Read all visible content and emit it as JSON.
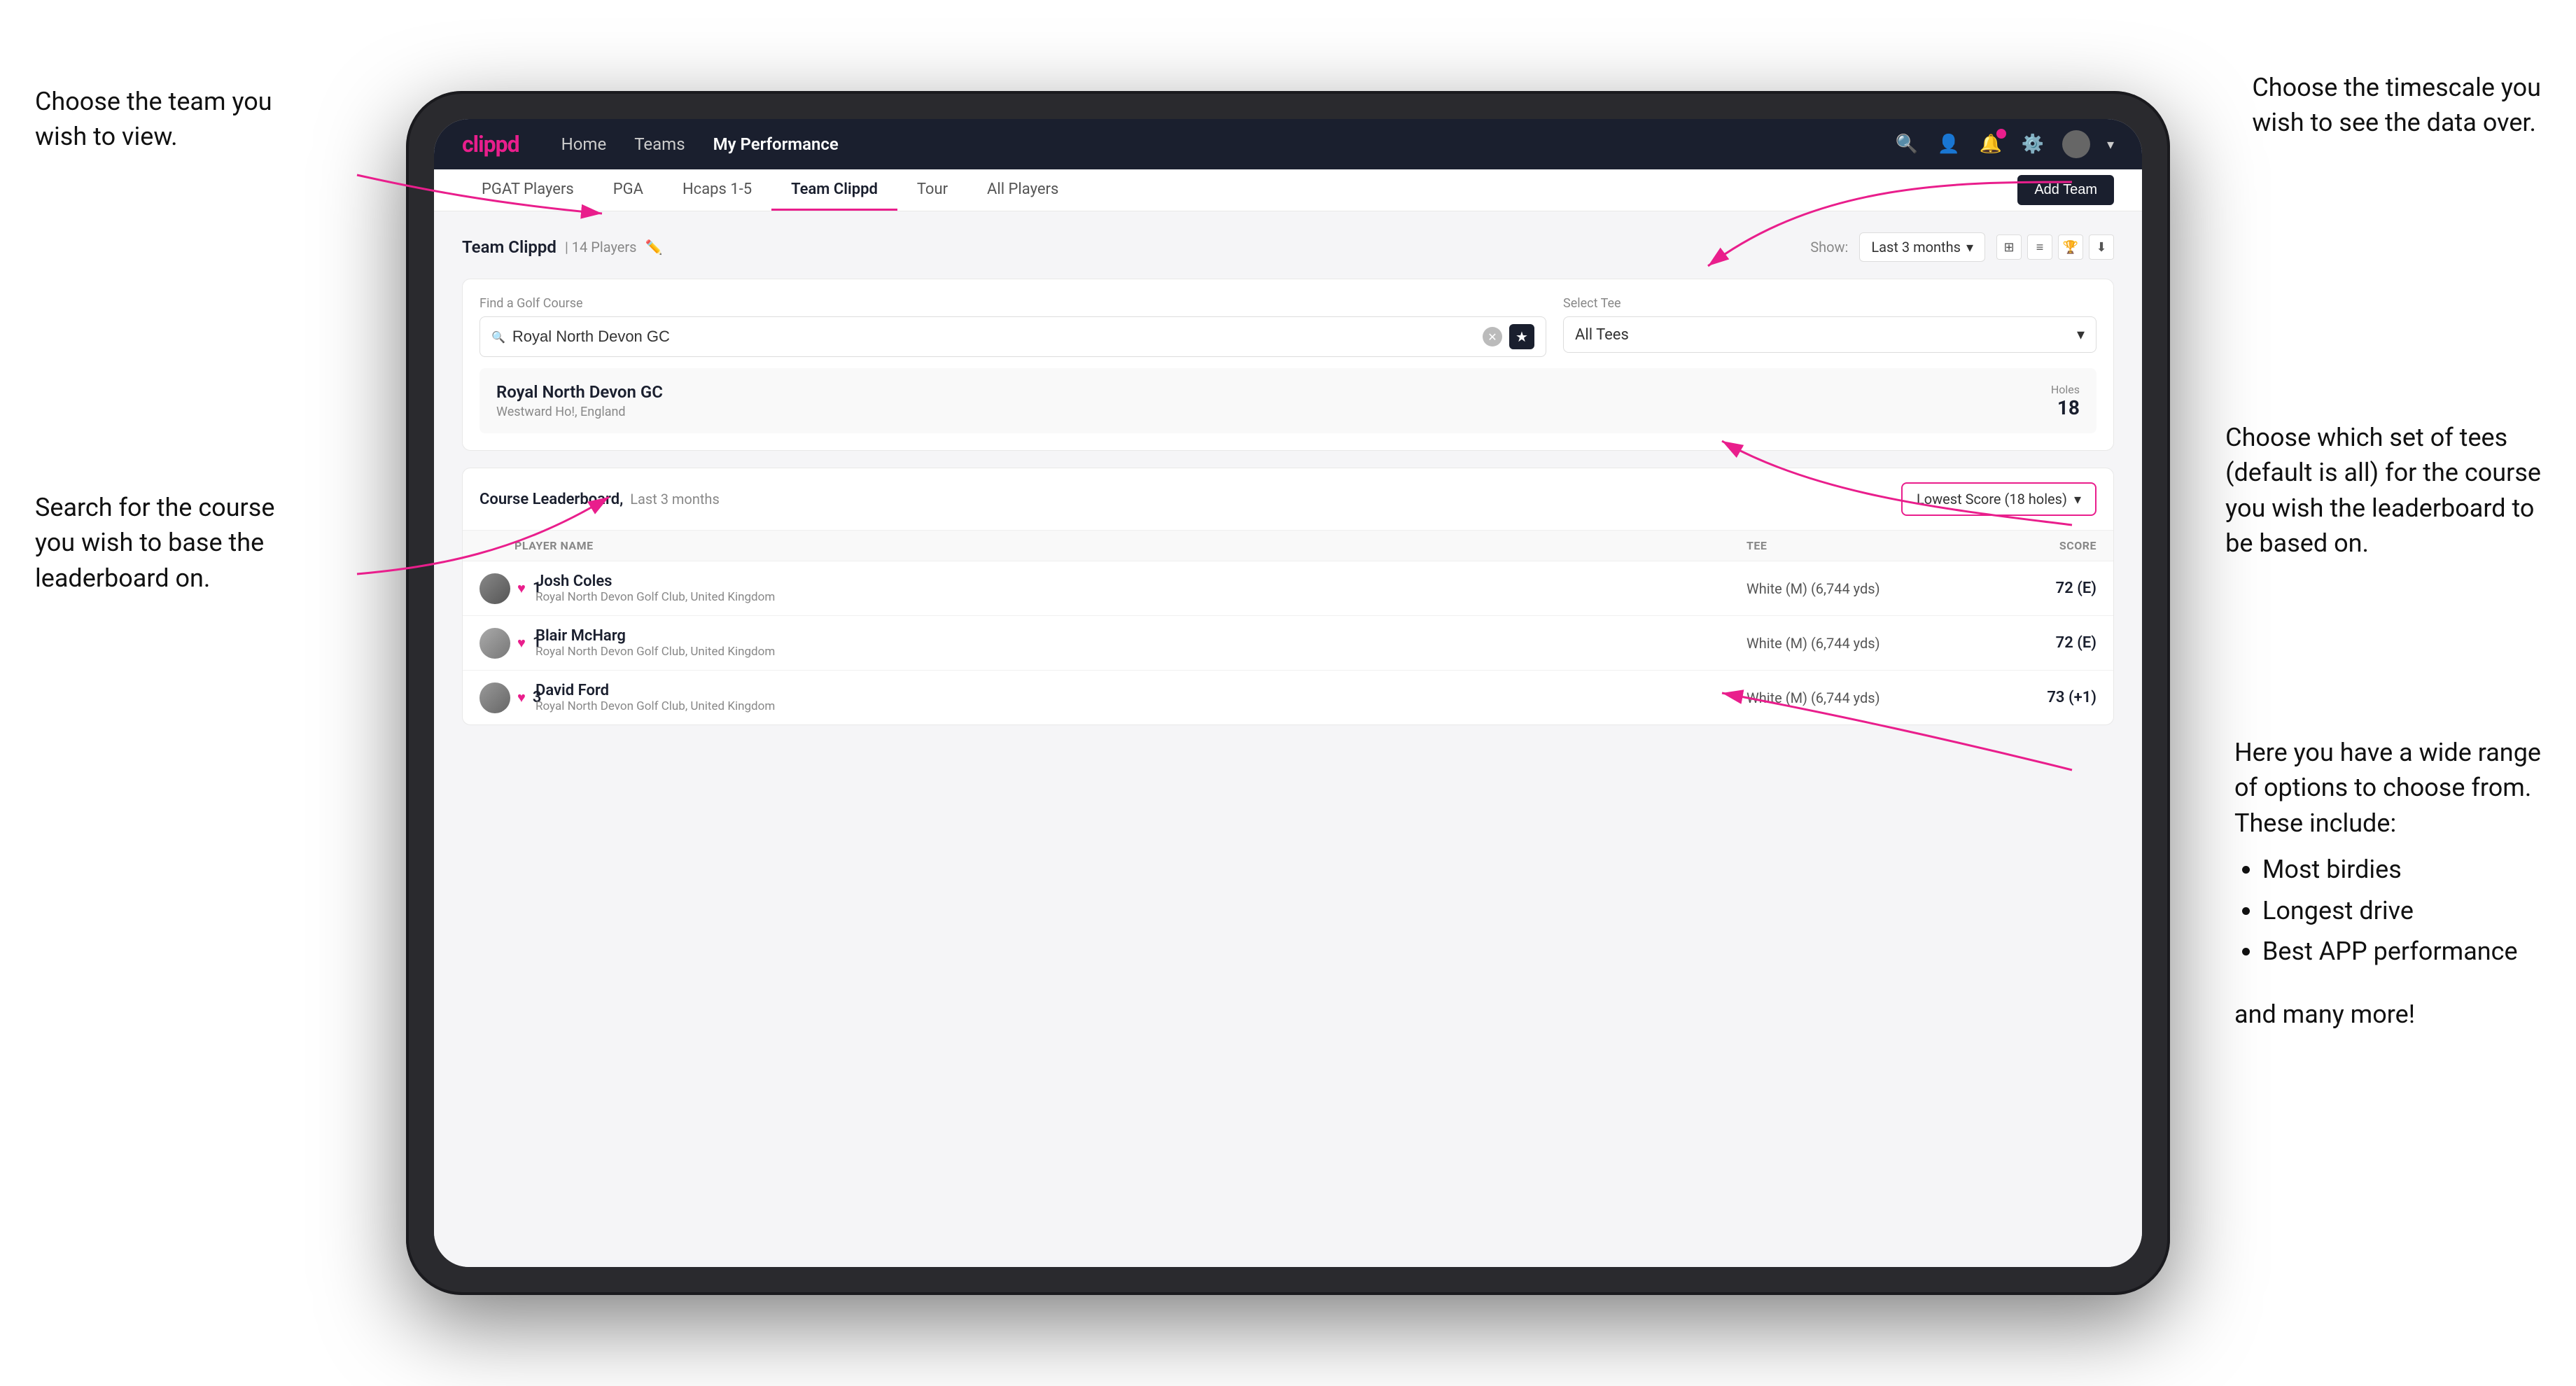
{
  "annotations": {
    "top_left": {
      "title": "Choose the team you\nwish to view."
    },
    "bottom_left": {
      "title": "Search for the course\nyou wish to base the\nleaderboard on."
    },
    "top_right": {
      "title": "Choose the timescale you\nwish to see the data over."
    },
    "middle_right": {
      "title": "Choose which set of tees\n(default is all) for the course\nyou wish the leaderboard to\nbe based on."
    },
    "lower_right": {
      "title": "Here you have a wide range\nof options to choose from.\nThese include:"
    },
    "bullet_items": [
      "Most birdies",
      "Longest drive",
      "Best APP performance"
    ],
    "and_more": "and many more!"
  },
  "nav": {
    "logo": "clippd",
    "links": [
      "Home",
      "Teams",
      "My Performance"
    ],
    "active_link": "My Performance"
  },
  "sub_nav": {
    "tabs": [
      "PGAT Players",
      "PGA",
      "Hcaps 1-5",
      "Team Clippd",
      "Tour",
      "All Players"
    ],
    "active_tab": "Team Clippd",
    "add_team_label": "Add Team"
  },
  "team_section": {
    "title": "Team Clippd",
    "count": "14 Players",
    "show_label": "Show:",
    "show_value": "Last 3 months"
  },
  "search_section": {
    "find_label": "Find a Golf Course",
    "search_value": "Royal North Devon GC",
    "tee_label": "Select Tee",
    "tee_value": "All Tees"
  },
  "course_result": {
    "name": "Royal North Devon GC",
    "location": "Westward Ho!, England",
    "holes_label": "Holes",
    "holes_num": "18"
  },
  "leaderboard": {
    "title": "Course Leaderboard,",
    "subtitle": "Last 3 months",
    "score_dropdown": "Lowest Score (18 holes)",
    "columns": [
      "PLAYER NAME",
      "TEE",
      "SCORE"
    ],
    "rows": [
      {
        "rank": "1",
        "name": "Josh Coles",
        "club": "Royal North Devon Golf Club, United Kingdom",
        "tee": "White (M) (6,744 yds)",
        "score": "72 (E)"
      },
      {
        "rank": "1",
        "name": "Blair McHarg",
        "club": "Royal North Devon Golf Club, United Kingdom",
        "tee": "White (M) (6,744 yds)",
        "score": "72 (E)"
      },
      {
        "rank": "3",
        "name": "David Ford",
        "club": "Royal North Devon Golf Club, United Kingdom",
        "tee": "White (M) (6,744 yds)",
        "score": "73 (+1)"
      }
    ]
  }
}
